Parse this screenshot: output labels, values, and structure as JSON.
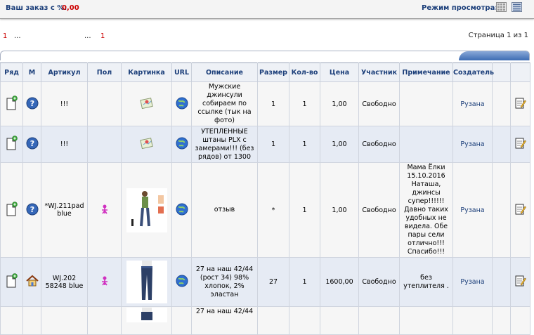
{
  "header": {
    "order_label": "Ваш заказ с %:",
    "order_value": "0,00",
    "view_mode_label": "Режим просмотра:",
    "view_icons": [
      "grid-view-icon",
      "list-view-icon"
    ]
  },
  "pagination": {
    "first": "1",
    "dots_left": "...",
    "dots_right": "...",
    "last": "1",
    "page_info": "Страница 1 из 1"
  },
  "table": {
    "headers": [
      "Ряд",
      "М",
      "Артикул",
      "Пол",
      "Картинка",
      "URL",
      "Описание",
      "Размер",
      "Кол-во",
      "Цена",
      "Участник",
      "Примечание",
      "Создатель",
      "",
      ""
    ],
    "rows": [
      {
        "row_icon": "add-document-icon",
        "status_icon": "question-icon",
        "article": "!!!",
        "gender_icon": "",
        "picture": "map-pin-icon",
        "url_icon": "globe-icon",
        "description": "Мужские джинсули собираем по ссылке (тык на фото)",
        "size": "1",
        "qty": "1",
        "price": "1,00",
        "participant": "Свободно",
        "note": "",
        "creator": "Рузана",
        "edit_icon": "edit-note-icon"
      },
      {
        "row_icon": "add-document-icon",
        "status_icon": "question-icon",
        "article": "!!!",
        "gender_icon": "",
        "picture": "map-pin-icon",
        "url_icon": "globe-icon",
        "description": "УТЕПЛЕННЫЕ штаны PLX с замерами!!! (без рядов) от 1300",
        "size": "1",
        "qty": "1",
        "price": "1,00",
        "participant": "Свободно",
        "note": "",
        "creator": "Рузана",
        "edit_icon": "edit-note-icon"
      },
      {
        "row_icon": "add-document-icon",
        "status_icon": "question-icon",
        "article": "*WJ.211pad blue",
        "gender_icon": "female-icon",
        "picture": "product-photo-woman",
        "url_icon": "globe-icon",
        "description": "отзыв",
        "size": "*",
        "qty": "1",
        "price": "1,00",
        "participant": "Свободно",
        "note": "Мама Ёлки 15.10.2016 Наташа, джинсы супер!!!!!! Давно таких удобных не видела. Обе пары сели отлично!!! Спасибо!!!",
        "creator": "Рузана",
        "edit_icon": "edit-note-icon"
      },
      {
        "row_icon": "add-document-icon",
        "status_icon": "home-icon",
        "article": "WJ.202 58248 blue",
        "gender_icon": "female-icon",
        "picture": "product-photo-jeans",
        "url_icon": "globe-icon",
        "description": "27 на наш 42/44 (рост 34) 98% хлопок, 2% эластан",
        "size": "27",
        "qty": "1",
        "price": "1600,00",
        "participant": "Свободно",
        "note": "без утеплителя .",
        "creator": "Рузана",
        "edit_icon": "edit-note-icon"
      },
      {
        "row_icon": "",
        "status_icon": "",
        "article": "",
        "gender_icon": "",
        "picture": "product-photo-jeans",
        "url_icon": "",
        "description": "27 на наш 42/44",
        "size": "",
        "qty": "",
        "price": "",
        "participant": "",
        "note": "",
        "creator": "",
        "edit_icon": ""
      }
    ]
  }
}
